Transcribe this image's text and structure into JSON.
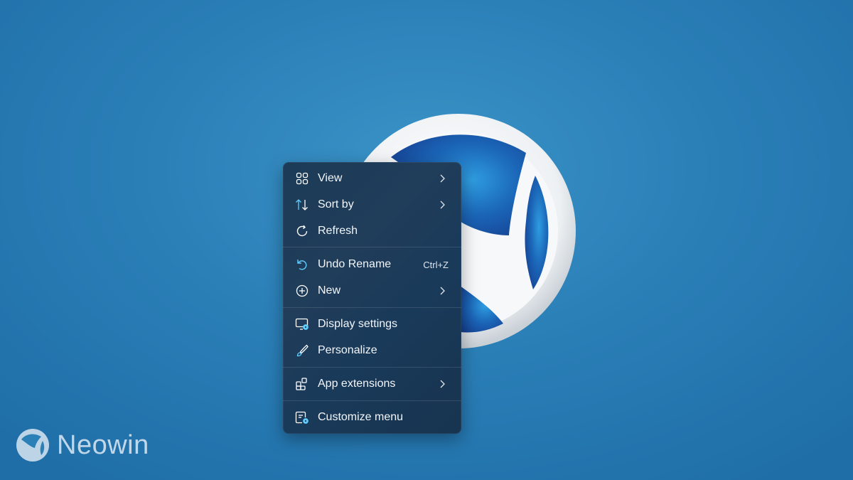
{
  "context_menu": {
    "items": [
      {
        "label": "View",
        "icon": "grid-icon",
        "has_submenu": true
      },
      {
        "label": "Sort by",
        "icon": "sort-arrows-icon",
        "has_submenu": true
      },
      {
        "label": "Refresh",
        "icon": "refresh-icon",
        "has_submenu": false
      },
      {
        "label": "Undo Rename",
        "icon": "undo-icon",
        "shortcut": "Ctrl+Z"
      },
      {
        "label": "New",
        "icon": "plus-circle-icon",
        "has_submenu": true
      },
      {
        "label": "Display settings",
        "icon": "monitor-gear-icon",
        "has_submenu": false
      },
      {
        "label": "Personalize",
        "icon": "brush-icon",
        "has_submenu": false
      },
      {
        "label": "App extensions",
        "icon": "extensions-icon",
        "has_submenu": true
      },
      {
        "label": "Customize menu",
        "icon": "customize-icon",
        "has_submenu": false
      }
    ]
  },
  "watermark": {
    "text": "Neowin"
  },
  "colors": {
    "background": "#2b80b8",
    "menu_background": "#1c3b57",
    "icon_accent": "#60cdff",
    "text": "#ffffff"
  }
}
